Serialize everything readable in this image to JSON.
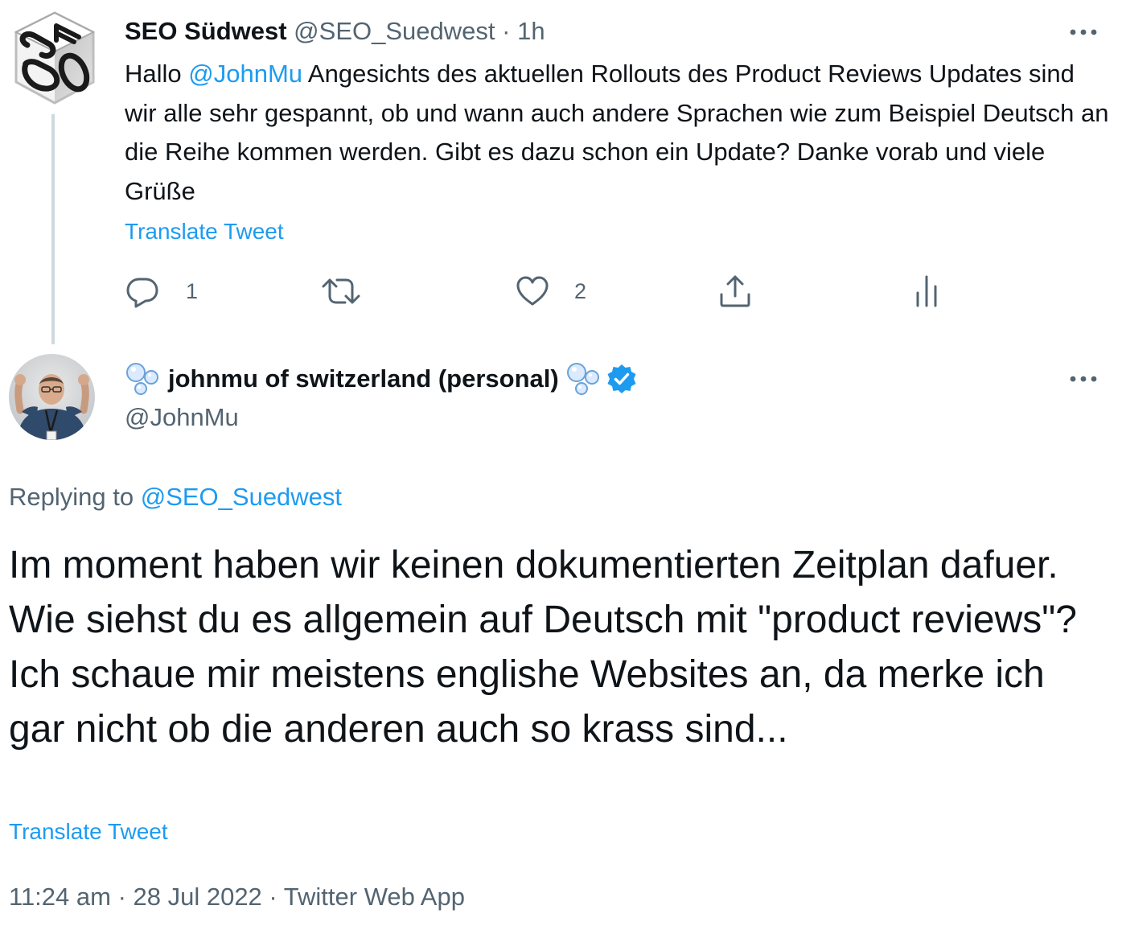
{
  "parent_tweet": {
    "author_name": "SEO Südwest",
    "author_handle": "@SEO_Suedwest",
    "separator": "·",
    "time_ago": "1h",
    "text_greeting": "Hallo ",
    "text_mention": "@JohnMu",
    "text_body": " Angesichts des aktuellen Rollouts des Product Reviews Updates sind wir alle sehr gespannt, ob und wann auch andere Sprachen wie zum Beispiel Deutsch an die Reihe kommen werden. Gibt es dazu schon ein Update? Danke vorab und viele Grüße",
    "translate_label": "Translate Tweet",
    "actions": {
      "reply_count": "1",
      "like_count": "2"
    }
  },
  "main_tweet": {
    "author_name": "johnmu of switzerland (personal)",
    "author_handle": "@JohnMu",
    "replying_prefix": "Replying to ",
    "replying_handle": "@SEO_Suedwest",
    "text": "Im moment haben wir keinen dokumentierten Zeitplan dafuer. Wie siehst du es allgemein auf Deutsch mit \"product reviews\"? Ich schaue mir meistens englishe Websites an, da merke ich gar nicht ob die anderen auch so krass sind...",
    "translate_label": "Translate Tweet",
    "timestamp": "11:24 am · 28 Jul 2022 · Twitter Web App"
  },
  "icons": {
    "more": "more-horizontal-icon",
    "reply": "reply-icon",
    "retweet": "retweet-icon",
    "like": "heart-icon",
    "share": "share-icon",
    "analytics": "analytics-icon",
    "verified": "verified-badge-icon",
    "bubbles": "soap-bubbles-emoji"
  },
  "colors": {
    "link": "#1d9bf0",
    "text": "#0f1419",
    "secondary": "#536471",
    "verified": "#1d9bf0",
    "thread_line": "#cfd9de"
  }
}
